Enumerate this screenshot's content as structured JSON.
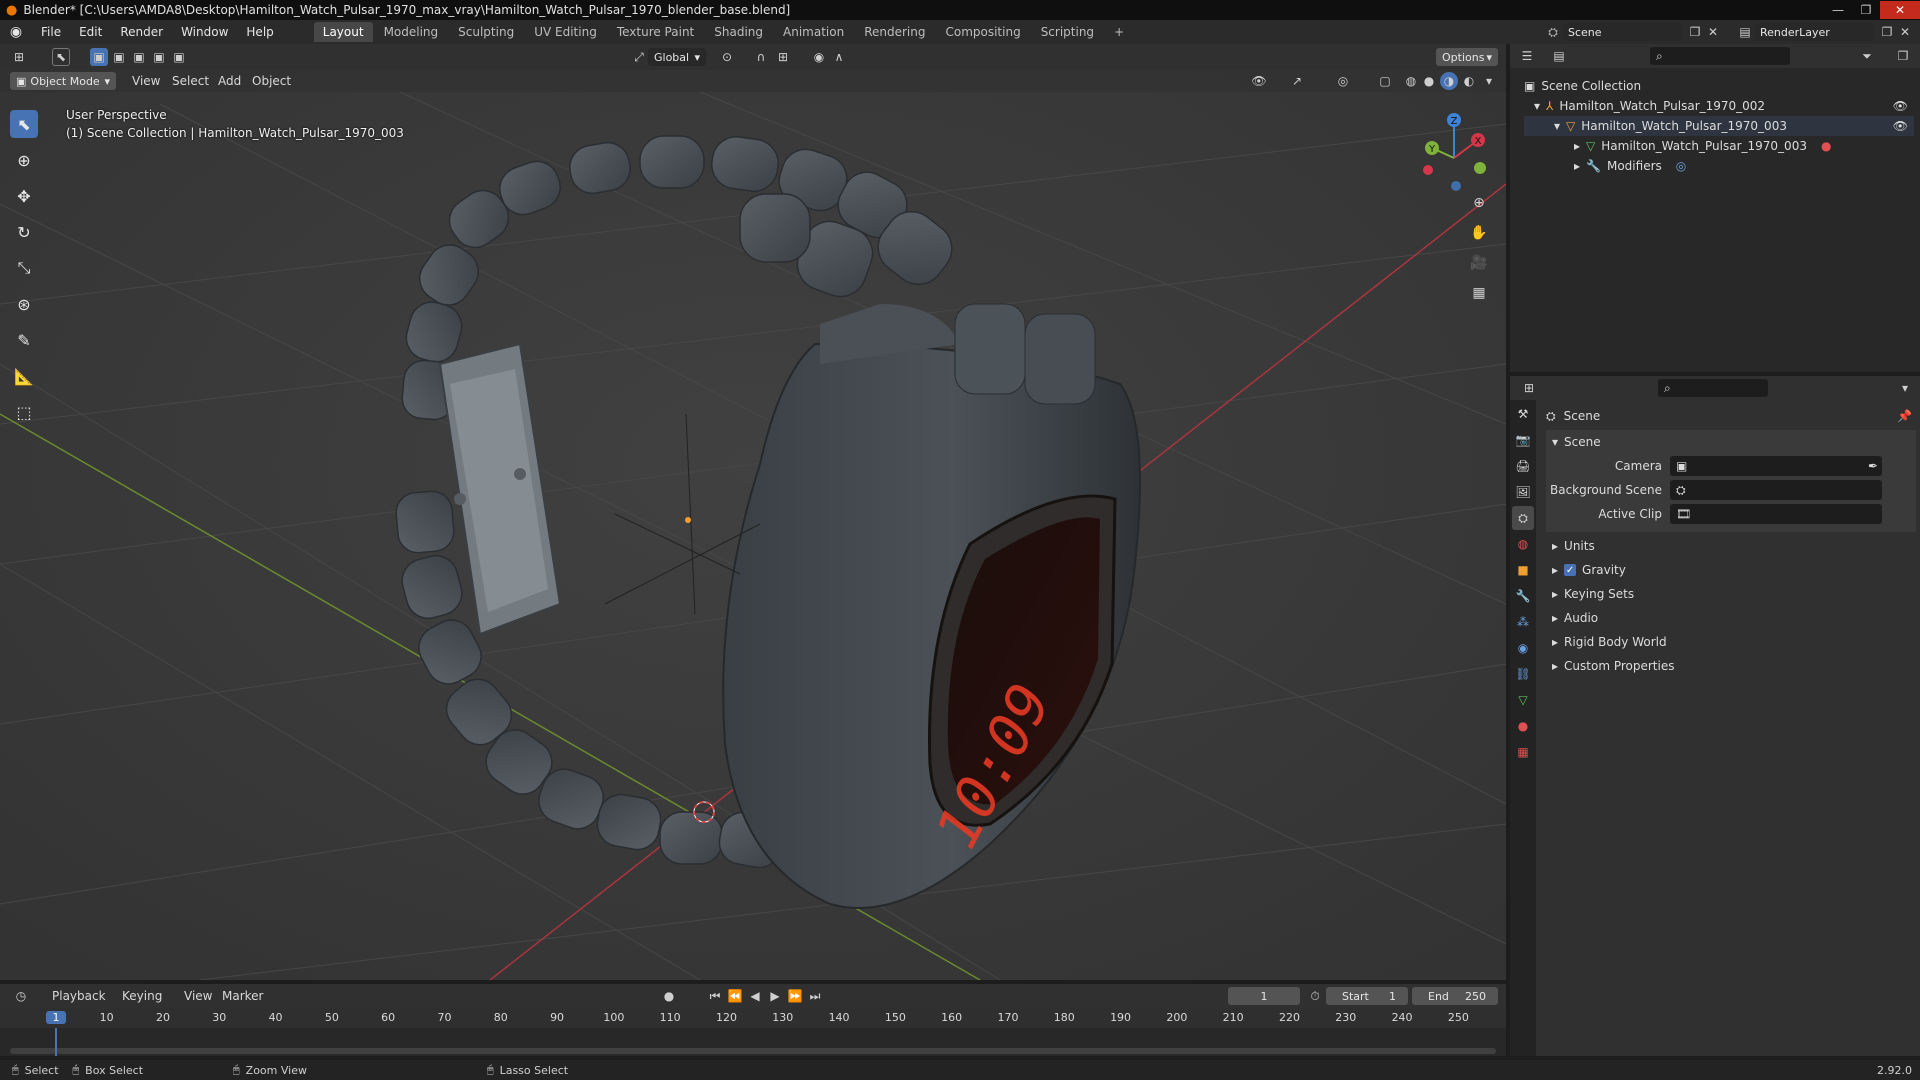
{
  "window": {
    "title": "Blender* [C:\\Users\\AMDA8\\Desktop\\Hamilton_Watch_Pulsar_1970_max_vray\\Hamilton_Watch_Pulsar_1970_blender_base.blend]",
    "minimize": "—",
    "maximize": "❐",
    "close": "✕"
  },
  "menu": [
    "File",
    "Edit",
    "Render",
    "Window",
    "Help"
  ],
  "workspaces": [
    "Layout",
    "Modeling",
    "Sculpting",
    "UV Editing",
    "Texture Paint",
    "Shading",
    "Animation",
    "Rendering",
    "Compositing",
    "Scripting"
  ],
  "workspace_add": "+",
  "scene_selector": {
    "value": "Scene"
  },
  "layer_selector": {
    "value": "RenderLayer"
  },
  "viewport": {
    "transform_orientation": "Global",
    "options_label": "Options",
    "mode": "Object Mode",
    "header_menus": [
      "View",
      "Select",
      "Add",
      "Object"
    ],
    "perspective_label": "User Perspective",
    "collection_label": "(1) Scene Collection | Hamilton_Watch_Pulsar_1970_003",
    "gizmo": {
      "x": "X",
      "y": "Y",
      "z": "Z"
    },
    "watch_display": "10:09"
  },
  "outliner": {
    "root": "Scene Collection",
    "items": [
      {
        "label": "Hamilton_Watch_Pulsar_1970_002",
        "depth": 1,
        "expanded": true
      },
      {
        "label": "Hamilton_Watch_Pulsar_1970_003",
        "depth": 2,
        "expanded": true
      },
      {
        "label": "Hamilton_Watch_Pulsar_1970_003",
        "depth": 3,
        "expanded": false
      },
      {
        "label": "Modifiers",
        "depth": 3,
        "expanded": false
      }
    ]
  },
  "properties": {
    "context_title": "Scene",
    "panel_title": "Scene",
    "fields": [
      {
        "label": "Camera",
        "value": ""
      },
      {
        "label": "Background Scene",
        "value": ""
      },
      {
        "label": "Active Clip",
        "value": ""
      }
    ],
    "subpanels": [
      {
        "label": "Units",
        "checkbox": false
      },
      {
        "label": "Gravity",
        "checkbox": true
      },
      {
        "label": "Keying Sets",
        "checkbox": false
      },
      {
        "label": "Audio",
        "checkbox": false
      },
      {
        "label": "Rigid Body World",
        "checkbox": false
      },
      {
        "label": "Custom Properties",
        "checkbox": false
      }
    ]
  },
  "timeline": {
    "menus": [
      "Playback",
      "Keying",
      "View",
      "Marker"
    ],
    "current_frame": "1",
    "start_label": "Start",
    "start_value": "1",
    "end_label": "End",
    "end_value": "250",
    "ticks": [
      "1",
      "10",
      "20",
      "30",
      "40",
      "50",
      "60",
      "70",
      "80",
      "90",
      "100",
      "110",
      "120",
      "130",
      "140",
      "150",
      "160",
      "170",
      "180",
      "190",
      "200",
      "210",
      "220",
      "230",
      "240",
      "250"
    ]
  },
  "statusbar": {
    "select": "Select",
    "box_select": "Box Select",
    "zoom_view": "Zoom View",
    "lasso_select": "Lasso Select",
    "version": "2.92.0"
  },
  "colors": {
    "accent": "#4772b3",
    "x_axis": "#d6364a",
    "y_axis": "#7fb23a",
    "z_axis": "#3f83d6",
    "led": "#e43a24"
  }
}
